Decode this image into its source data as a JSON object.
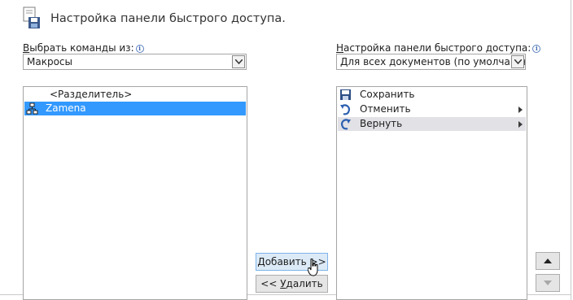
{
  "header": {
    "title": "Настройка панели быстрого доступа."
  },
  "left": {
    "label": "Выбрать команды из:",
    "label_accel": "В",
    "label_rest": "ыбрать команды из:",
    "combo_value": "Макросы",
    "items": [
      {
        "label": "<Разделитель>",
        "icon": "none",
        "selected": false
      },
      {
        "label": "Zamena",
        "icon": "macro-icon",
        "selected": true
      }
    ]
  },
  "right": {
    "label": "Настройка панели быстрого доступа:",
    "label_accel": "Н",
    "label_rest": "астройка панели быстрого доступа:",
    "combo_value": "Для всех документов (по умолчанию)",
    "items": [
      {
        "label": "Сохранить",
        "icon": "save-icon",
        "submenu": false
      },
      {
        "label": "Отменить",
        "icon": "undo-icon",
        "submenu": true
      },
      {
        "label": "Вернуть",
        "icon": "redo-icon",
        "submenu": true,
        "hover": true
      }
    ]
  },
  "buttons": {
    "add": "Добавить >>",
    "add_accel": "Д",
    "add_rest": "обавить >>",
    "remove": "<< Удалить",
    "remove_prefix": "<< ",
    "remove_accel": "У",
    "remove_rest": "далить"
  },
  "colors": {
    "selection": "#3399ff",
    "hover_row": "#e1e1e6",
    "border": "#a5a5a5",
    "button_face": "#e5e5e5"
  }
}
